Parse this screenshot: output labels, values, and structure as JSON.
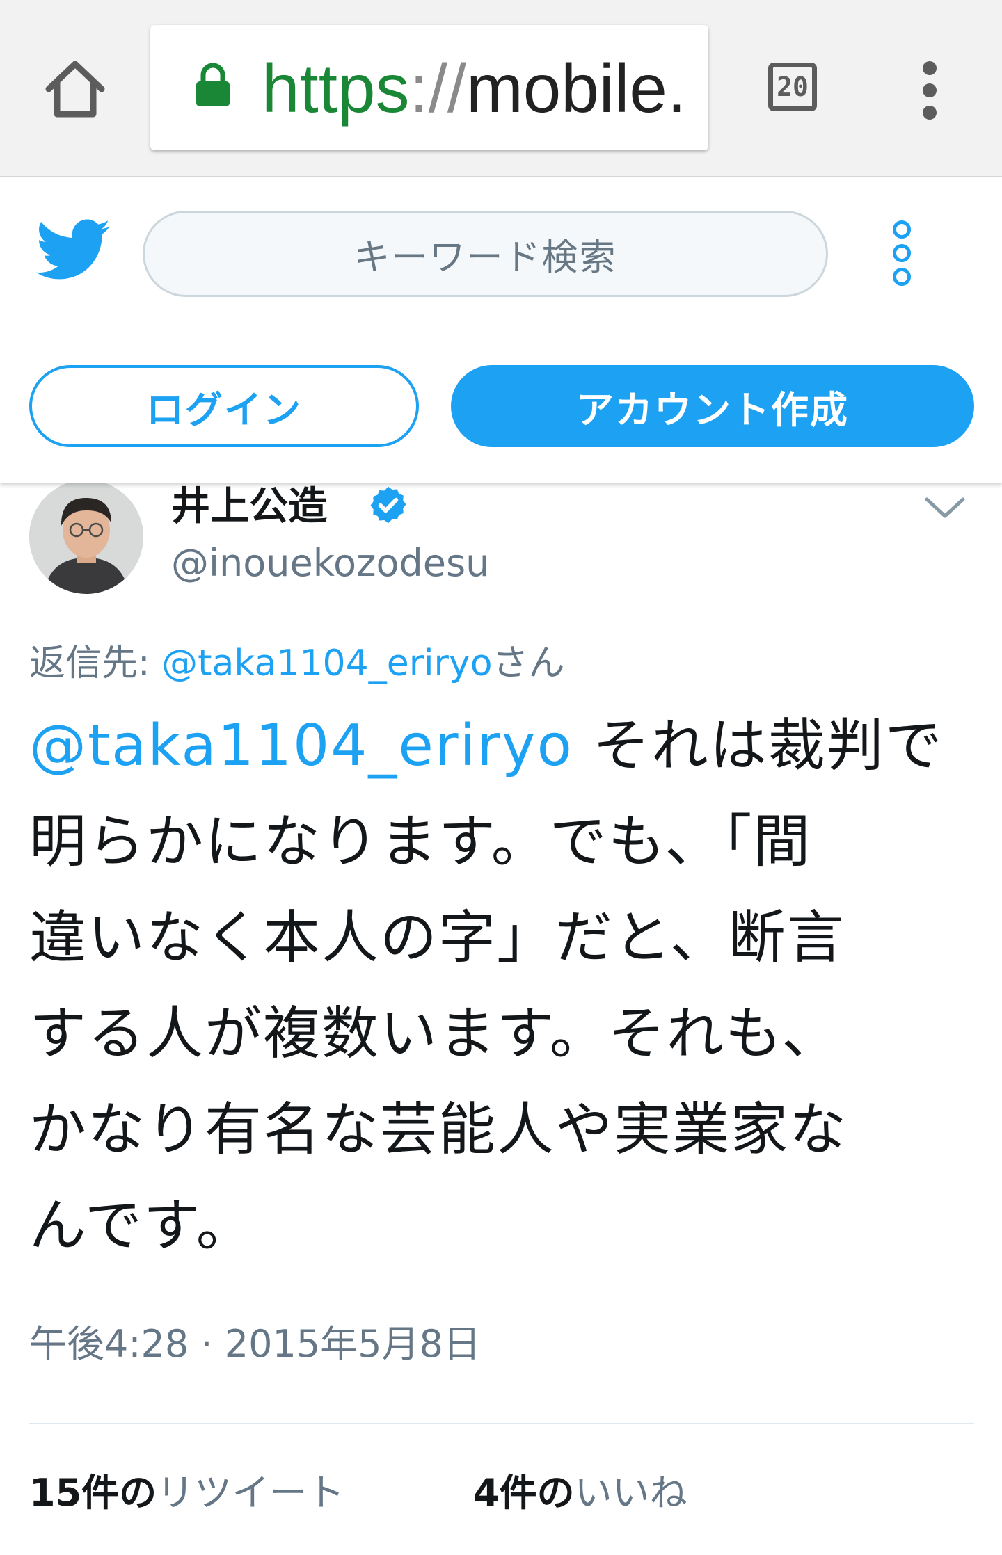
{
  "browser": {
    "url_scheme": "https",
    "url_sep": "://",
    "url_rest": "mobile.",
    "tab_count": "20",
    "icons": [
      "home-icon",
      "lock-icon",
      "tab-switcher-icon",
      "overflow-menu-icon"
    ]
  },
  "twitter_header": {
    "search_placeholder": "キーワード検索",
    "login_label": "ログイン",
    "signup_label": "アカウント作成",
    "brand_color": "#1da1f2"
  },
  "tweet": {
    "display_name": "井上公造",
    "username": "@inouekozodesu",
    "reply_prefix": "返信先: ",
    "reply_mention": "@taka1104_eriryo",
    "reply_suffix": "さん",
    "text_mention": "@taka1104_eriryo",
    "text_lines": [
      " それは裁判で",
      "明らかになります。でも、「間",
      "違いなく本人の字」だと、断言",
      "する人が複数います。それも、",
      "かなり有名な芸能人や実業家な",
      "んです。"
    ],
    "timestamp": "午後4:28 · 2015年5月8日",
    "retweet_count": "15",
    "retweet_suffix": "件の",
    "retweet_label": "リツイート",
    "like_count": "4",
    "like_suffix": "件の",
    "like_label": "いいね"
  }
}
